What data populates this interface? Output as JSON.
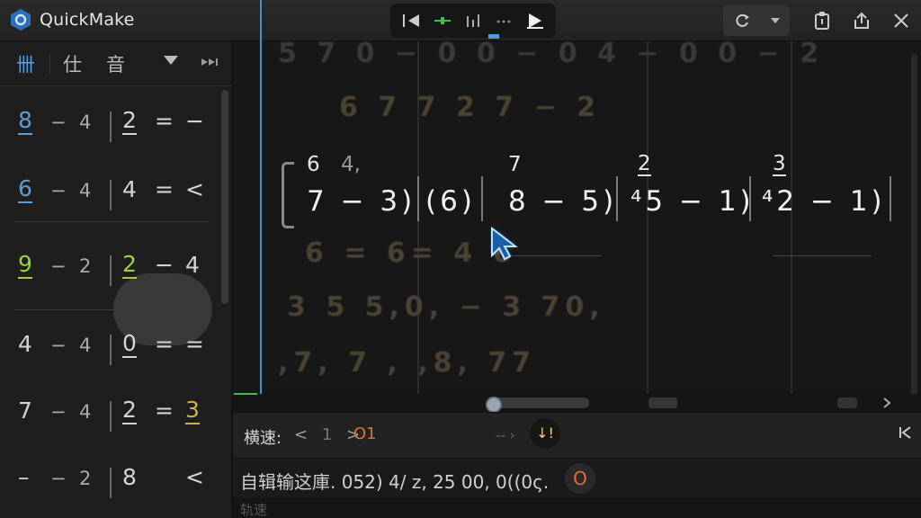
{
  "app": {
    "title": "QuickMake"
  },
  "colors": {
    "accent": "#3f8fd4",
    "green": "#9bd13a",
    "orange": "#e0703a"
  },
  "transport": [
    "rewind-icon",
    "waveform-icon",
    "levels-icon",
    "dots-icon",
    "play-icon"
  ],
  "sidebar": {
    "tabs": [
      "卌",
      "仕",
      "音"
    ],
    "rows": [
      {
        "a": "8",
        "op": "−",
        "b": "4",
        "c": "2",
        "d": "=",
        "e": "−"
      },
      {
        "a": "6",
        "op": "−",
        "b": "4",
        "c": "4",
        "d": "=",
        "e": "<"
      },
      {
        "a": "9",
        "op": "−",
        "b": "2",
        "c": "2",
        "d": "−",
        "e": "4"
      },
      {
        "a": "4",
        "op": "−",
        "b": "4",
        "c": "0",
        "d": "=",
        "e": "="
      },
      {
        "a": "7",
        "op": "−",
        "b": "4",
        "c": "2",
        "d": "=",
        "e": "3"
      },
      {
        "a": "–",
        "op": "−",
        "b": "2",
        "c": "8",
        "d": "",
        "e": "<"
      }
    ]
  },
  "main": {
    "faded_rows": [
      "5 7 0 − 0    0 − 0    4 − 0    0 − 2",
      "6 7    7    2 7 − 2",
      "6 =    6=    4    6",
      "3    5    5,0, − 3    70,",
      ",7,    7 ,    ,8,    77"
    ],
    "superscripts": [
      "6",
      "4,",
      "7",
      "2",
      "3"
    ],
    "expressions": [
      "7 − 3)",
      "(6)",
      "8 − 5)",
      "⁴5 − 1)",
      "⁴2 − 1)"
    ]
  },
  "speed": {
    "label": "横速:",
    "prev": "<",
    "value_num": "1",
    "next": ">",
    "current": "O1",
    "mid": "-- ›",
    "knob": "↓!"
  },
  "status": {
    "text": "自辑输这庫. 052) 4/ z, 25 00, 0((0ς.",
    "badge": "O"
  },
  "footer": {
    "label": "轨速"
  }
}
